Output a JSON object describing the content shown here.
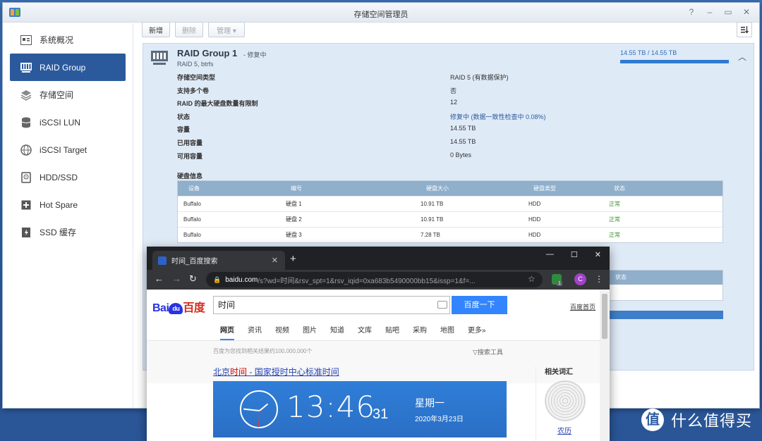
{
  "dsm": {
    "title": "存储空间管理员",
    "sidebar": [
      {
        "label": "系统概况",
        "icon": "overview-icon"
      },
      {
        "label": "RAID Group",
        "icon": "raid-icon",
        "active": true
      },
      {
        "label": "存储空间",
        "icon": "volume-icon"
      },
      {
        "label": "iSCSI LUN",
        "icon": "lun-icon"
      },
      {
        "label": "iSCSI Target",
        "icon": "target-icon"
      },
      {
        "label": "HDD/SSD",
        "icon": "disk-icon"
      },
      {
        "label": "Hot Spare",
        "icon": "hotspare-icon"
      },
      {
        "label": "SSD 缓存",
        "icon": "ssd-cache-icon"
      }
    ],
    "toolbar": {
      "create": "新增",
      "delete": "删除",
      "manage": "管理 ▾"
    },
    "raid": {
      "name": "RAID Group 1",
      "status_tag": "- 修复中",
      "sub": "RAID 5, btrfs",
      "capacity": "14.55 TB / 14.55 TB",
      "capacity_fraction": 1.0,
      "props": [
        {
          "label": "存储空间类型",
          "value": "RAID 5 (有数据保护)"
        },
        {
          "label": "支持多个卷",
          "value": "否"
        },
        {
          "label": "RAID 的最大硬盘数量有限制",
          "value": "12"
        },
        {
          "label": "状态",
          "value": "修复中 (数据一致性检查中 0.08%)",
          "blue": true
        },
        {
          "label": "容量",
          "value": "14.55 TB"
        },
        {
          "label": "已用容量",
          "value": "14.55 TB"
        },
        {
          "label": "可用容量",
          "value": "0 Bytes"
        }
      ],
      "disk_info_label": "硬盘信息",
      "disk_columns": [
        "设备",
        "编号",
        "硬盘大小",
        "硬盘类型",
        "状态"
      ],
      "disks": [
        {
          "device": "Buffalo",
          "id": "硬盘 1",
          "size": "10.91 TB",
          "type": "HDD",
          "status": "正常"
        },
        {
          "device": "Buffalo",
          "id": "硬盘 2",
          "size": "10.91 TB",
          "type": "HDD",
          "status": "正常"
        },
        {
          "device": "Buffalo",
          "id": "硬盘 3",
          "size": "7.28 TB",
          "type": "HDD",
          "status": "正常"
        }
      ],
      "second_table_status": "状态"
    }
  },
  "chrome": {
    "tab_title": "时间_百度搜索",
    "url_host": "baidu.com",
    "url_path": "/s?wd=时间&rsv_spt=1&rsv_iqid=0xa683b5490000bb15&issp=1&f=...",
    "ext_badge": "1",
    "avatar": "C"
  },
  "baidu": {
    "logo_left": "Bai",
    "logo_paw": "du",
    "logo_right": "百度",
    "query": "时间",
    "search_button": "百度一下",
    "home_link": "百度首页",
    "tabs": [
      "网页",
      "资讯",
      "视频",
      "图片",
      "知道",
      "文库",
      "贴吧",
      "采购",
      "地图",
      "更多»"
    ],
    "result_count": "百度为您找到相关结果约100,000,000个",
    "search_tools": "▽搜索工具",
    "result_prefix": "北京",
    "result_highlight": "时间",
    "result_suffix": " - 国家授时中心标准时间",
    "clock": {
      "time": "13:46",
      "seconds": "31",
      "weekday": "星期一",
      "date": "2020年3月23日"
    },
    "related_title": "相关词汇",
    "related_label": "农历"
  },
  "watermark": {
    "logo": "值",
    "text": "什么值得买"
  }
}
